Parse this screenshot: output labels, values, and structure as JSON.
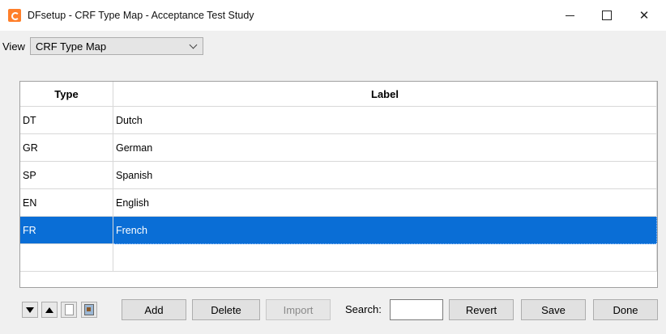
{
  "window": {
    "title": "DFsetup - CRF Type Map - Acceptance Test Study",
    "minimize": "–",
    "close": "✕"
  },
  "view": {
    "label": "View",
    "selected": "CRF Type Map"
  },
  "table": {
    "columns": [
      "Type",
      "Label"
    ],
    "rows": [
      {
        "type": "DT",
        "label": "Dutch"
      },
      {
        "type": "GR",
        "label": "German"
      },
      {
        "type": "SP",
        "label": "Spanish"
      },
      {
        "type": "EN",
        "label": "English"
      },
      {
        "type": "FR",
        "label": "French"
      },
      {
        "type": "",
        "label": ""
      }
    ],
    "selected_row": 4
  },
  "toolbar": {
    "move_down_icon": "triangle-down",
    "move_up_icon": "triangle-up",
    "new_doc_icon": "document",
    "import_file_icon": "import-file",
    "add": "Add",
    "delete": "Delete",
    "import": "Import",
    "search_label": "Search:",
    "search_value": "",
    "revert": "Revert",
    "save": "Save",
    "done": "Done"
  },
  "colors": {
    "selection": "#0a6ed6",
    "app_icon": "#ff7f2a"
  }
}
